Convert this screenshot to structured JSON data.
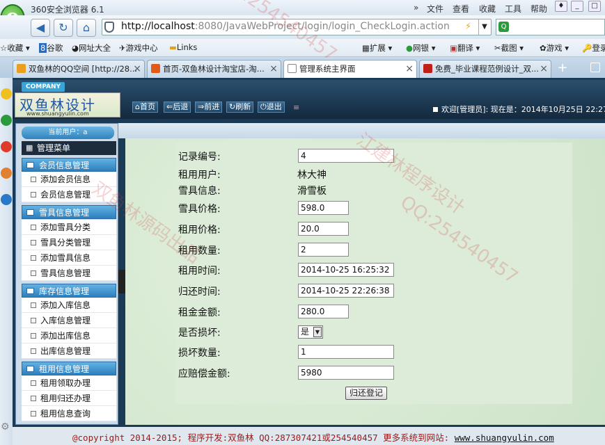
{
  "browser": {
    "title": "360安全浏览器 6.1",
    "menus": [
      "文件",
      "查看",
      "收藏",
      "工具",
      "帮助"
    ],
    "address_host": "http://localhost",
    "address_rest": ":8080/JavaWebProject/login/login_CheckLogin.action",
    "favorites": [
      "收藏",
      "谷歌",
      "网址大全",
      "游戏中心",
      "Links",
      "扩展",
      "网银",
      "翻译",
      "截图",
      "游戏",
      "登录"
    ],
    "tabs": [
      {
        "label": "双鱼林的QQ空间 [http://28...",
        "active": false,
        "color": "#e8a020"
      },
      {
        "label": "首页-双鱼林设计淘宝店-淘...",
        "active": false,
        "color": "#e05a1a"
      },
      {
        "label": "管理系统主界面",
        "active": true,
        "color": "#ffffff"
      },
      {
        "label": "免费_毕业课程范例设计_双...",
        "active": false,
        "color": "#c0201a"
      }
    ]
  },
  "header": {
    "company": "COMPANY",
    "brand_name": "双鱼林设计",
    "brand_url": "www.shuangyulin.com",
    "toolbar": [
      "首页",
      "后退",
      "前进",
      "刷新",
      "退出"
    ],
    "welcome": "欢迎[管理员]:   现在是：2014年10月25日 22:27"
  },
  "sidebar": {
    "current_user_label": "当前用户：a",
    "menu_title": "管理菜单",
    "groups": [
      {
        "title": "会员信息管理",
        "items": [
          "添加会员信息",
          "会员信息管理"
        ]
      },
      {
        "title": "雪具信息管理",
        "items": [
          "添加雪具分类",
          "雪具分类管理",
          "添加雪具信息",
          "雪具信息管理"
        ]
      },
      {
        "title": "库存信息管理",
        "items": [
          "添加入库信息",
          "入库信息管理",
          "添加出库信息",
          "出库信息管理"
        ]
      },
      {
        "title": "租用信息管理",
        "items": [
          "租用领取办理",
          "租用归还办理",
          "租用信息查询"
        ]
      }
    ]
  },
  "form": {
    "record_id_label": "记录编号:",
    "record_id": "4",
    "user_label": "租用用户:",
    "user": "林大神",
    "gear_label": "雪具信息:",
    "gear": "滑雪板",
    "gear_price_label": "雪具价格:",
    "gear_price": "598.0",
    "rent_price_label": "租用价格:",
    "rent_price": "20.0",
    "rent_qty_label": "租用数量:",
    "rent_qty": "2",
    "rent_time_label": "租用时间:",
    "rent_time": "2014-10-25 16:25:32",
    "return_time_label": "归还时间:",
    "return_time": "2014-10-25 22:26:38",
    "deposit_label": "租金金额:",
    "deposit": "280.0",
    "damaged_label": "是否损坏:",
    "damaged": "是",
    "damage_qty_label": "损坏数量:",
    "damage_qty": "1",
    "compensation_label": "应赔偿金额:",
    "compensation": "5980",
    "submit_label": "归还登记"
  },
  "footer": {
    "text": "@copyright 2014-2015; 程序开发:双鱼林  QQ:287307421或254540457  更多系统到网站: ",
    "link": "www.shuangyulin.com"
  },
  "watermarks": [
    "QQ:254540457",
    "双鱼林源码出品",
    "江建林程序设计"
  ]
}
